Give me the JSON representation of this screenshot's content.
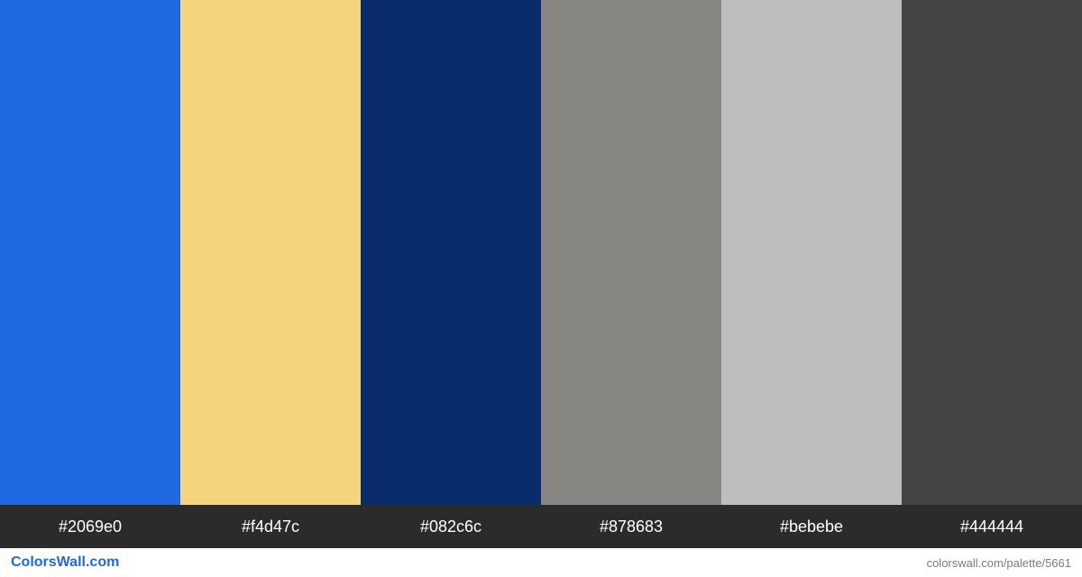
{
  "colors": [
    {
      "hex": "#2069e0"
    },
    {
      "hex": "#f4d47c"
    },
    {
      "hex": "#082c6c"
    },
    {
      "hex": "#878683"
    },
    {
      "hex": "#bebebe"
    },
    {
      "hex": "#444444"
    }
  ],
  "brand": {
    "first": "Colors",
    "second": "Wall.com"
  },
  "palette_url": "colorswall.com/palette/5661"
}
